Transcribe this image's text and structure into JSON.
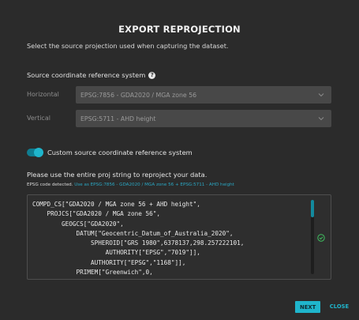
{
  "dialog": {
    "title": "EXPORT REPROJECTION",
    "subtitle": "Select the source projection used when capturing the dataset."
  },
  "source_crs": {
    "label": "Source coordinate reference system",
    "help_icon": "question-circle-icon",
    "horizontal": {
      "label": "Horizontal",
      "value": "EPSG:7856 - GDA2020 / MGA zone 56"
    },
    "vertical": {
      "label": "Vertical",
      "value": "EPSG:5711 - AHD height"
    }
  },
  "custom_toggle": {
    "label": "Custom source coordinate reference system",
    "on": true
  },
  "proj": {
    "instruction": "Please use the entire proj string to reproject your data.",
    "detected_prefix": "EPSG code detected.",
    "detected_link": "Use as EPSG:7856 - GDA2020 / MGA zone 56 + EPSG:5711 - AHD height",
    "lines": [
      "COMPD_CS[\"GDA2020 / MGA zone 56 + AHD height\",",
      "    PROJCS[\"GDA2020 / MGA zone 56\",",
      "        GEOGCS[\"GDA2020\",",
      "            DATUM[\"Geocentric_Datum_of_Australia_2020\",",
      "                SPHEROID[\"GRS 1980\",6378137,298.257222101,",
      "                    AUTHORITY[\"EPSG\",\"7019\"]],",
      "                AUTHORITY[\"EPSG\",\"1168\"]],",
      "            PRIMEM[\"Greenwich\",0,"
    ],
    "valid_icon": "check-circle-icon"
  },
  "actions": {
    "next": "NEXT",
    "close": "CLOSE"
  },
  "colors": {
    "accent": "#1fb5cc",
    "background": "#2b2b2b",
    "success": "#3fbf5f"
  }
}
